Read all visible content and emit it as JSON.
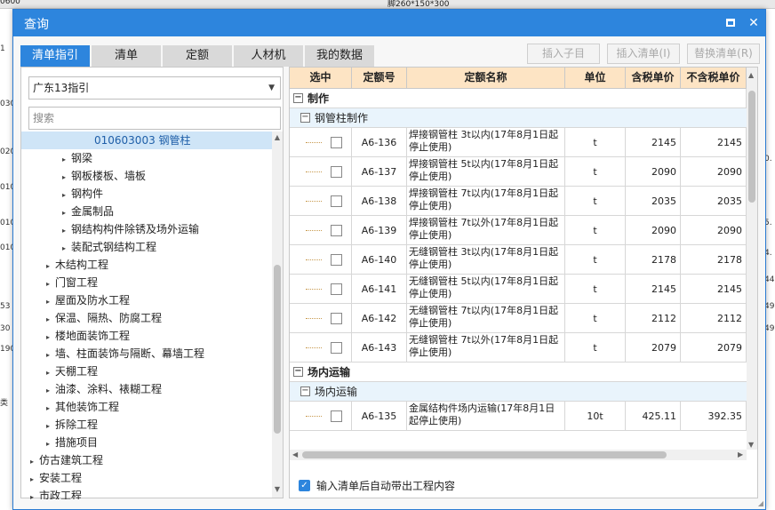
{
  "background": {
    "top_text": "脚260*150*300",
    "top_left": "0600",
    "left_cells": [
      "1",
      "030",
      "020",
      "010",
      "010",
      "010",
      "53",
      "30",
      "190",
      "类"
    ],
    "right_cells": [
      "",
      "",
      "0.",
      "",
      "5.",
      "4.",
      "44",
      "49",
      "49"
    ]
  },
  "dialog": {
    "title": "查询",
    "maximize_label": "",
    "close_label": "✕"
  },
  "tabs": [
    {
      "label": "清单指引"
    },
    {
      "label": "清单"
    },
    {
      "label": "定额"
    },
    {
      "label": "人材机"
    },
    {
      "label": "我的数据"
    }
  ],
  "toolbar": {
    "insert_child": "插入子目",
    "insert_list": "插入清单(I)",
    "replace_list": "替换清单(R)"
  },
  "left": {
    "guide_select": "广东13指引",
    "search_placeholder": "搜索",
    "tree": [
      {
        "label": "010603003  钢管柱",
        "indent": 82,
        "caret": "",
        "selected": true
      },
      {
        "label": "钢梁",
        "indent": 46,
        "caret": "▸"
      },
      {
        "label": "钢板楼板、墙板",
        "indent": 46,
        "caret": "▸"
      },
      {
        "label": "钢构件",
        "indent": 46,
        "caret": "▸"
      },
      {
        "label": "金属制品",
        "indent": 46,
        "caret": "▸"
      },
      {
        "label": "钢结构构件除锈及场外运输",
        "indent": 46,
        "caret": "▸"
      },
      {
        "label": "装配式钢结构工程",
        "indent": 46,
        "caret": "▸"
      },
      {
        "label": "木结构工程",
        "indent": 28,
        "caret": "▸"
      },
      {
        "label": "门窗工程",
        "indent": 28,
        "caret": "▸"
      },
      {
        "label": "屋面及防水工程",
        "indent": 28,
        "caret": "▸"
      },
      {
        "label": "保温、隔热、防腐工程",
        "indent": 28,
        "caret": "▸"
      },
      {
        "label": "楼地面装饰工程",
        "indent": 28,
        "caret": "▸"
      },
      {
        "label": "墙、柱面装饰与隔断、幕墙工程",
        "indent": 28,
        "caret": "▸"
      },
      {
        "label": "天棚工程",
        "indent": 28,
        "caret": "▸"
      },
      {
        "label": "油漆、涂料、裱糊工程",
        "indent": 28,
        "caret": "▸"
      },
      {
        "label": "其他装饰工程",
        "indent": 28,
        "caret": "▸"
      },
      {
        "label": "拆除工程",
        "indent": 28,
        "caret": "▸"
      },
      {
        "label": "措施项目",
        "indent": 28,
        "caret": "▸"
      },
      {
        "label": "仿古建筑工程",
        "indent": 10,
        "caret": "▸"
      },
      {
        "label": "安装工程",
        "indent": 10,
        "caret": "▸"
      },
      {
        "label": "市政工程",
        "indent": 10,
        "caret": "▸"
      }
    ]
  },
  "grid": {
    "columns": [
      "选中",
      "定额号",
      "定额名称",
      "单位",
      "含税单价",
      "不含税单价"
    ],
    "groups": [
      {
        "title": "制作",
        "subgroups": [
          {
            "title": "钢管柱制作",
            "rows": [
              {
                "code": "A6-136",
                "name": "焊接钢管柱 3t以内(17年8月1日起停止使用)",
                "unit": "t",
                "price_tax": "2145",
                "price_notax": "2145"
              },
              {
                "code": "A6-137",
                "name": "焊接钢管柱 5t以内(17年8月1日起停止使用)",
                "unit": "t",
                "price_tax": "2090",
                "price_notax": "2090"
              },
              {
                "code": "A6-138",
                "name": "焊接钢管柱 7t以内(17年8月1日起停止使用)",
                "unit": "t",
                "price_tax": "2035",
                "price_notax": "2035"
              },
              {
                "code": "A6-139",
                "name": "焊接钢管柱 7t以外(17年8月1日起停止使用)",
                "unit": "t",
                "price_tax": "2090",
                "price_notax": "2090"
              },
              {
                "code": "A6-140",
                "name": "无缝钢管柱 3t以内(17年8月1日起停止使用)",
                "unit": "t",
                "price_tax": "2178",
                "price_notax": "2178"
              },
              {
                "code": "A6-141",
                "name": "无缝钢管柱 5t以内(17年8月1日起停止使用)",
                "unit": "t",
                "price_tax": "2145",
                "price_notax": "2145"
              },
              {
                "code": "A6-142",
                "name": "无缝钢管柱 7t以内(17年8月1日起停止使用)",
                "unit": "t",
                "price_tax": "2112",
                "price_notax": "2112"
              },
              {
                "code": "A6-143",
                "name": "无缝钢管柱 7t以外(17年8月1日起停止使用)",
                "unit": "t",
                "price_tax": "2079",
                "price_notax": "2079"
              }
            ]
          }
        ]
      },
      {
        "title": "场内运输",
        "subgroups": [
          {
            "title": "场内运输",
            "rows": [
              {
                "code": "A6-135",
                "name": "金属结构件场内运输(17年8月1日起停止使用)",
                "unit": "10t",
                "price_tax": "425.11",
                "price_notax": "392.35"
              }
            ]
          }
        ]
      }
    ]
  },
  "footer": {
    "auto_bring_label": "输入清单后自动带出工程内容"
  }
}
